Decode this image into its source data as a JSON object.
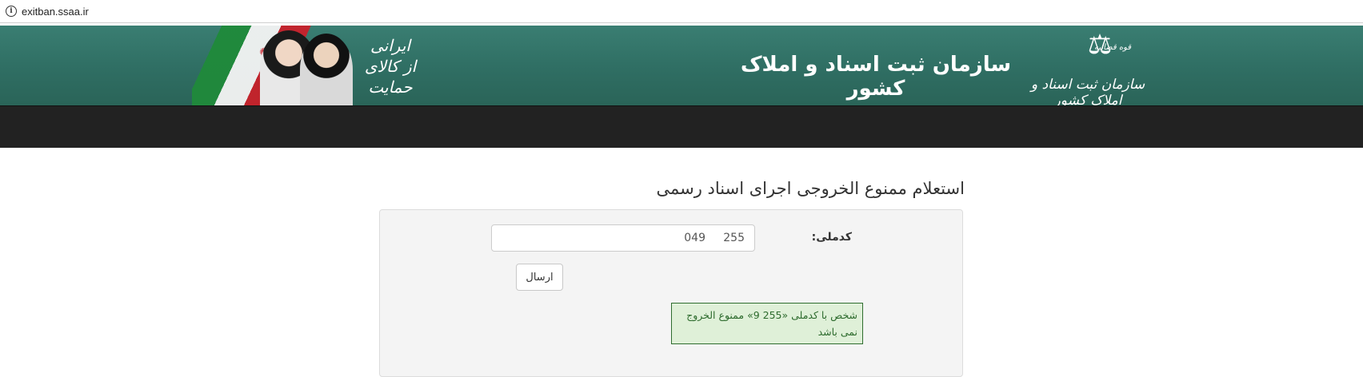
{
  "browser": {
    "url": "exitban.ssaa.ir"
  },
  "header": {
    "org_title": "سازمان ثبت اسناد و املاک کشور",
    "logo_text": "سازمان ثبت اسناد و املاک کشور",
    "logo_subtitle": "قوه قضائیه",
    "slogan_line1": "حمایت",
    "slogan_line2": "از کالای",
    "slogan_line3": "ایرانی"
  },
  "main": {
    "title": "استعلام ممنوع الخروجی اجرای اسناد رسمی",
    "form": {
      "national_code_label": "کدملی:",
      "national_code_value": "255     049",
      "submit_label": "ارسال"
    },
    "result": {
      "text": "شخص با کدملی «255      9» ممنوع الخروج نمی باشد"
    }
  },
  "colors": {
    "banner": "#2f6e63",
    "navbar": "#222222",
    "panel": "#f4f4f4",
    "result_border": "#2f6e2f",
    "result_text": "#2d6b2d"
  }
}
